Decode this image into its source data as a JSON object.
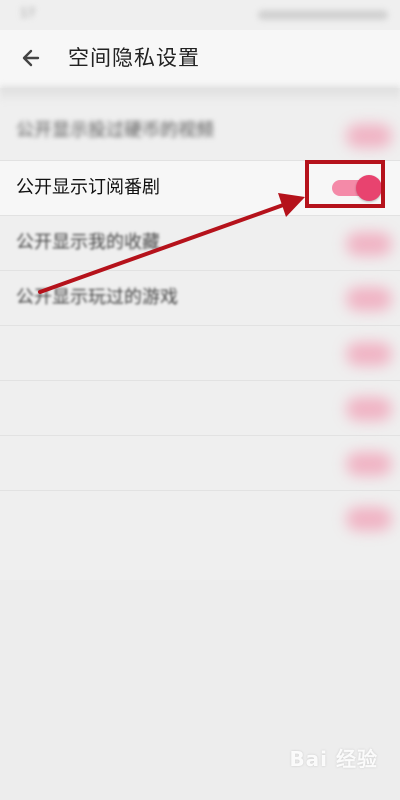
{
  "status_bar": {
    "left_text": "17"
  },
  "header": {
    "title": "空间隐私设置",
    "back_icon": "back-arrow-icon"
  },
  "privacy_list": {
    "items": [
      {
        "label": "公开显示投过硬币的视频",
        "toggle": "on"
      },
      {
        "label": "公开显示订阅番剧",
        "toggle": "on"
      },
      {
        "label": "公开显示我的收藏",
        "toggle": "on"
      },
      {
        "label": "公开显示玩过的游戏",
        "toggle": "on"
      },
      {
        "label": "",
        "toggle": "on"
      },
      {
        "label": "",
        "toggle": "on"
      },
      {
        "label": "",
        "toggle": "on"
      },
      {
        "label": "",
        "toggle": "on"
      }
    ]
  },
  "annotation": {
    "color": "#b5121b"
  },
  "accent_color": "#e8436f",
  "watermark": {
    "text": "Bai 经验"
  }
}
